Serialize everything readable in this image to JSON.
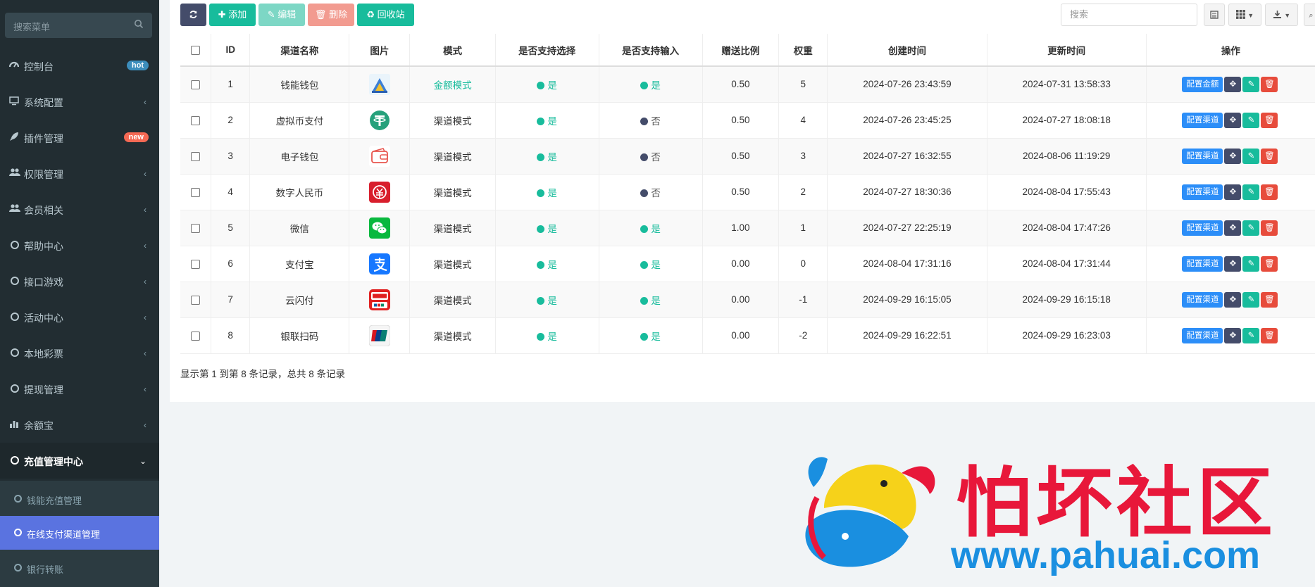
{
  "sidebar": {
    "search_placeholder": "搜索菜单",
    "items": [
      {
        "label": "控制台",
        "icon": "dashboard-icon",
        "badge": "hot",
        "badge_color": "#3c8dbc"
      },
      {
        "label": "系统配置",
        "icon": "monitor-icon"
      },
      {
        "label": "插件管理",
        "icon": "rocket-icon",
        "badge": "new",
        "badge_color": "#f56954"
      },
      {
        "label": "权限管理",
        "icon": "users-icon"
      },
      {
        "label": "会员相关",
        "icon": "users-icon"
      },
      {
        "label": "帮助中心",
        "icon": "circle-icon"
      },
      {
        "label": "接口游戏",
        "icon": "circle-icon"
      },
      {
        "label": "活动中心",
        "icon": "circle-icon"
      },
      {
        "label": "本地彩票",
        "icon": "circle-icon"
      },
      {
        "label": "提现管理",
        "icon": "circle-icon"
      },
      {
        "label": "余额宝",
        "icon": "bar-chart-icon"
      },
      {
        "label": "充值管理中心",
        "icon": "circle-icon"
      }
    ],
    "submenu": [
      {
        "label": "钱能充值管理"
      },
      {
        "label": "在线支付渠道管理",
        "active": true
      },
      {
        "label": "银行转账"
      }
    ]
  },
  "toolbar": {
    "refresh_icon": "refresh-icon",
    "add_label": "添加",
    "edit_label": "编辑",
    "delete_label": "删除",
    "recycle_label": "回收站",
    "search_placeholder": "搜索"
  },
  "table": {
    "headers": [
      "ID",
      "渠道名称",
      "图片",
      "模式",
      "是否支持选择",
      "是否支持输入",
      "赠送比例",
      "权重",
      "创建时间",
      "更新时间",
      "操作"
    ],
    "rows": [
      {
        "id": "1",
        "name": "钱能钱包",
        "logo": "qianneng-logo",
        "mode": "金额模式",
        "select": "是",
        "input": "是",
        "ratio": "0.50",
        "weight": "5",
        "created": "2024-07-26 23:43:59",
        "updated": "2024-07-31 13:58:33",
        "action": "配置金额"
      },
      {
        "id": "2",
        "name": "虚拟币支付",
        "logo": "tether-logo",
        "mode": "渠道模式",
        "select": "是",
        "input": "否",
        "ratio": "0.50",
        "weight": "4",
        "created": "2024-07-26 23:45:25",
        "updated": "2024-07-27 18:08:18",
        "action": "配置渠道"
      },
      {
        "id": "3",
        "name": "电子钱包",
        "logo": "wallet-logo",
        "mode": "渠道模式",
        "select": "是",
        "input": "否",
        "ratio": "0.50",
        "weight": "3",
        "created": "2024-07-27 16:32:55",
        "updated": "2024-08-06 11:19:29",
        "action": "配置渠道"
      },
      {
        "id": "4",
        "name": "数字人民币",
        "logo": "ecny-logo",
        "mode": "渠道模式",
        "select": "是",
        "input": "否",
        "ratio": "0.50",
        "weight": "2",
        "created": "2024-07-27 18:30:36",
        "updated": "2024-08-04 17:55:43",
        "action": "配置渠道"
      },
      {
        "id": "5",
        "name": "微信",
        "logo": "wechat-logo",
        "mode": "渠道模式",
        "select": "是",
        "input": "是",
        "ratio": "1.00",
        "weight": "1",
        "created": "2024-07-27 22:25:19",
        "updated": "2024-08-04 17:47:26",
        "action": "配置渠道"
      },
      {
        "id": "6",
        "name": "支付宝",
        "logo": "alipay-logo",
        "mode": "渠道模式",
        "select": "是",
        "input": "是",
        "ratio": "0.00",
        "weight": "0",
        "created": "2024-08-04 17:31:16",
        "updated": "2024-08-04 17:31:44",
        "action": "配置渠道"
      },
      {
        "id": "7",
        "name": "云闪付",
        "logo": "unionpay-quickpass-logo",
        "mode": "渠道模式",
        "select": "是",
        "input": "是",
        "ratio": "0.00",
        "weight": "-1",
        "created": "2024-09-29 16:15:05",
        "updated": "2024-09-29 16:15:18",
        "action": "配置渠道"
      },
      {
        "id": "8",
        "name": "银联扫码",
        "logo": "unionpay-logo",
        "mode": "渠道模式",
        "select": "是",
        "input": "是",
        "ratio": "0.00",
        "weight": "-2",
        "created": "2024-09-29 16:22:51",
        "updated": "2024-09-29 16:23:03",
        "action": "配置渠道"
      }
    ]
  },
  "footer": {
    "summary": "显示第 1 到第 8 条记录，总共 8 条记录"
  },
  "watermark": {
    "title": "怕坏社区",
    "url": "www.pahuai.com"
  },
  "colors": {
    "sidebar_bg": "#222d32",
    "active_sub": "#5a73e0",
    "success": "#18bc9c",
    "danger": "#e74c3c",
    "primary": "#2c8ef8"
  }
}
